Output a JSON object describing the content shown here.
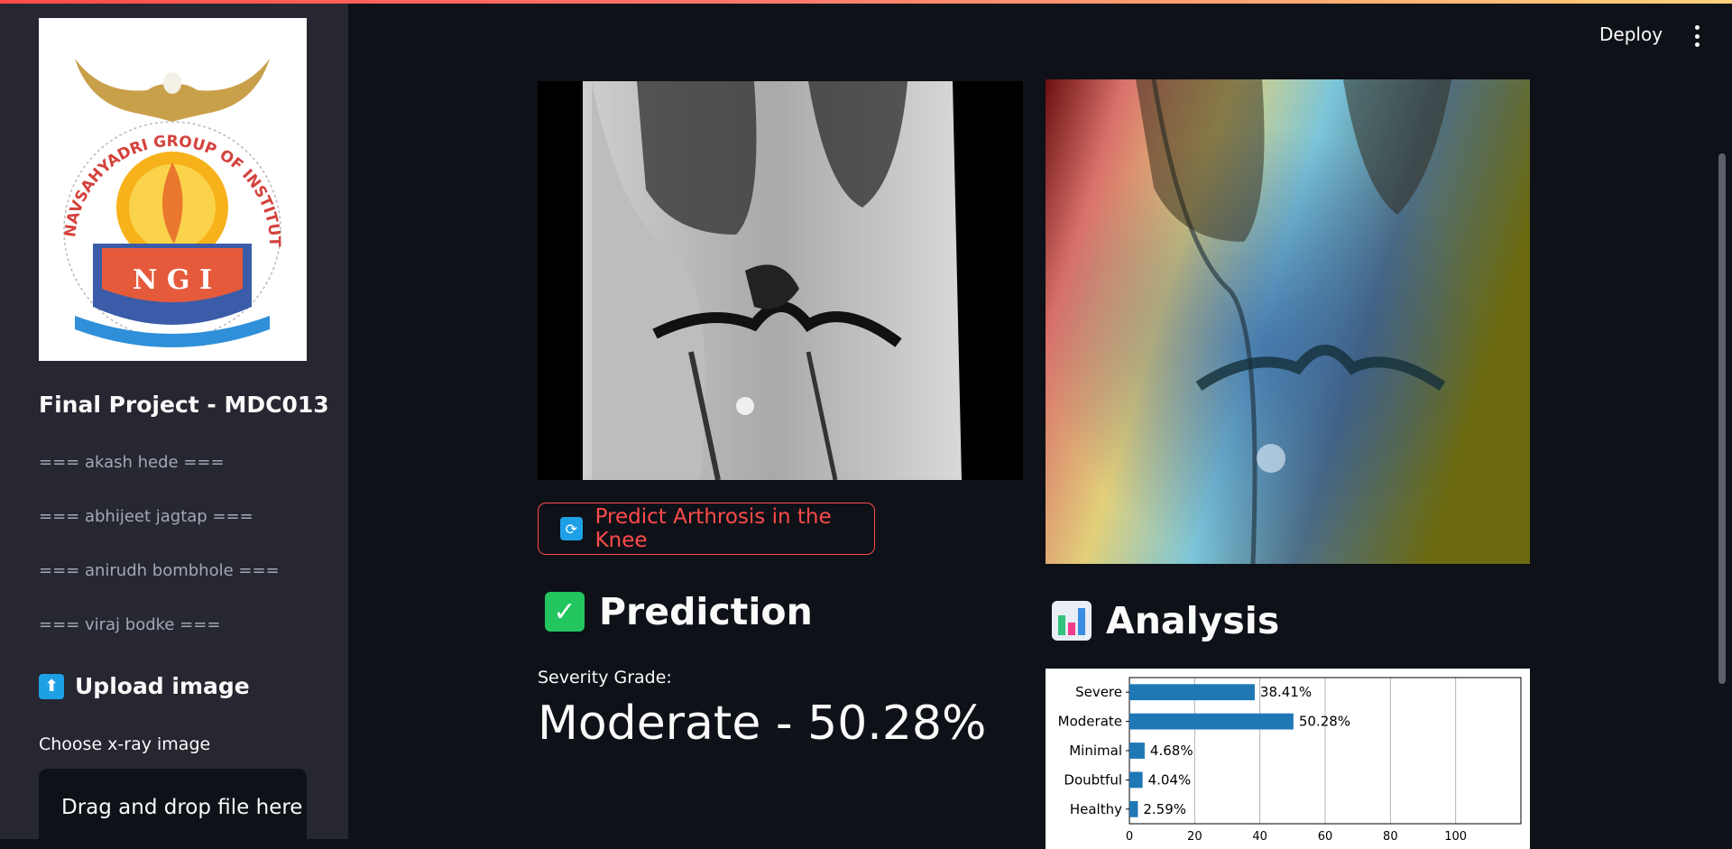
{
  "sidebar": {
    "project_title": "Final Project - MDC013",
    "members": [
      "=== akash hede ===",
      "=== abhijeet jagtap ===",
      "=== anirudh bombhole ===",
      "=== viraj bodke ==="
    ],
    "logo": {
      "arc_text": "NAVSAHYADRI GROUP OF INSTITUTIONS, PUNE",
      "letters": "N G I"
    },
    "upload_heading": "Upload image",
    "upload_icon": "up-arrow-icon",
    "choose_label": "Choose x-ray image",
    "dropzone_text": "Drag and drop file here"
  },
  "header": {
    "deploy_label": "Deploy",
    "menu_icon": "kebab-menu-icon"
  },
  "main": {
    "predict_button_label": "Predict Arthrosis in the Knee",
    "predict_button_icon": "refresh-icon",
    "prediction_heading": "Prediction",
    "prediction_icon": "check-mark-icon",
    "severity_label": "Severity Grade:",
    "severity_value": "Moderate - 50.28%",
    "analysis_heading": "Analysis",
    "analysis_icon": "bar-chart-icon"
  },
  "colors": {
    "accent": "#ff4b4b",
    "background": "#0e1117",
    "sidebar": "#262730",
    "bar": "#1f77b4"
  },
  "chart_data": {
    "type": "bar",
    "orientation": "horizontal",
    "categories": [
      "Severe",
      "Moderate",
      "Minimal",
      "Doubtful",
      "Healthy"
    ],
    "values": [
      38.41,
      50.28,
      4.68,
      4.04,
      2.59
    ],
    "value_labels": [
      "38.41%",
      "50.28%",
      "4.68%",
      "4.04%",
      "2.59%"
    ],
    "x_ticks": [
      0,
      20,
      40,
      60,
      80,
      100
    ],
    "xlim": [
      0,
      120
    ],
    "grid": "vertical"
  }
}
